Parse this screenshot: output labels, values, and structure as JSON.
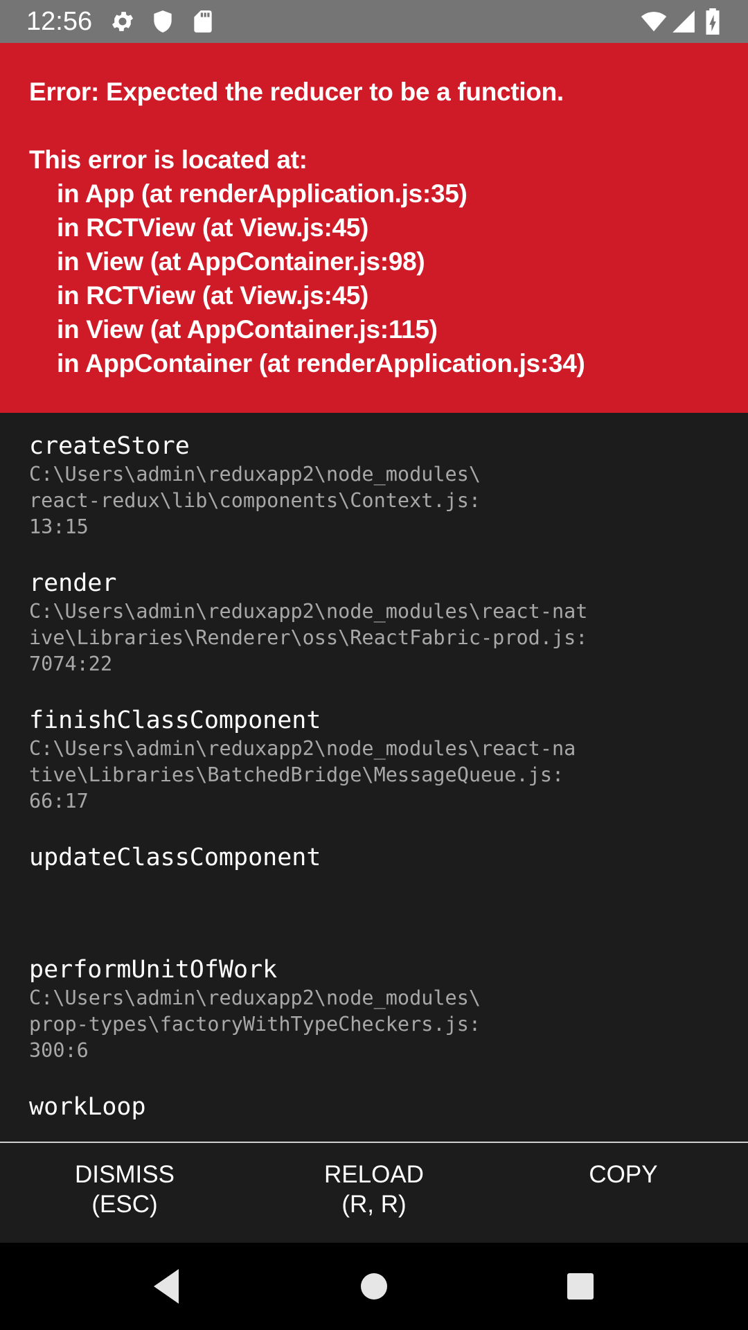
{
  "status_bar": {
    "time": "12:56",
    "left_icons": [
      "gear-icon",
      "shield-icon",
      "sd-card-icon"
    ],
    "right_icons": [
      "wifi-icon",
      "cell-signal-icon",
      "battery-charging-icon"
    ],
    "background": "#757575"
  },
  "error": {
    "title": "Error: Expected the reducer to be a function.",
    "located_label": "This error is located at:",
    "component_stack": [
      "in App (at renderApplication.js:35)",
      "in RCTView (at View.js:45)",
      "in View (at AppContainer.js:98)",
      "in RCTView (at View.js:45)",
      "in View (at AppContainer.js:115)",
      "in AppContainer (at renderApplication.js:34)"
    ],
    "background": "#cf1a28"
  },
  "stack_trace": {
    "frames": [
      {
        "method": "createStore",
        "file_lines": [
          "C:\\Users\\admin\\reduxapp2\\node_modules\\",
          "react-redux\\lib\\components\\Context.js:",
          "13:15"
        ]
      },
      {
        "method": "render",
        "file_lines": [
          "C:\\Users\\admin\\reduxapp2\\node_modules\\react-nat",
          "ive\\Libraries\\Renderer\\oss\\ReactFabric-prod.js:",
          "7074:22"
        ]
      },
      {
        "method": "finishClassComponent",
        "file_lines": [
          "C:\\Users\\admin\\reduxapp2\\node_modules\\react-na",
          "tive\\Libraries\\BatchedBridge\\MessageQueue.js:",
          "66:17"
        ]
      },
      {
        "method": "updateClassComponent",
        "file_lines": []
      },
      {
        "method": "performUnitOfWork",
        "file_lines": [
          "C:\\Users\\admin\\reduxapp2\\node_modules\\",
          "prop-types\\factoryWithTypeCheckers.js:",
          "300:6"
        ]
      },
      {
        "method": "workLoop",
        "file_lines": []
      }
    ],
    "background": "#1c1c1c"
  },
  "actions": {
    "dismiss": "DISMISS\n(ESC)",
    "reload": "RELOAD\n(R, R)",
    "copy": "COPY"
  },
  "nav_bar": {
    "icons": [
      "back-icon",
      "home-icon",
      "recents-icon"
    ]
  }
}
